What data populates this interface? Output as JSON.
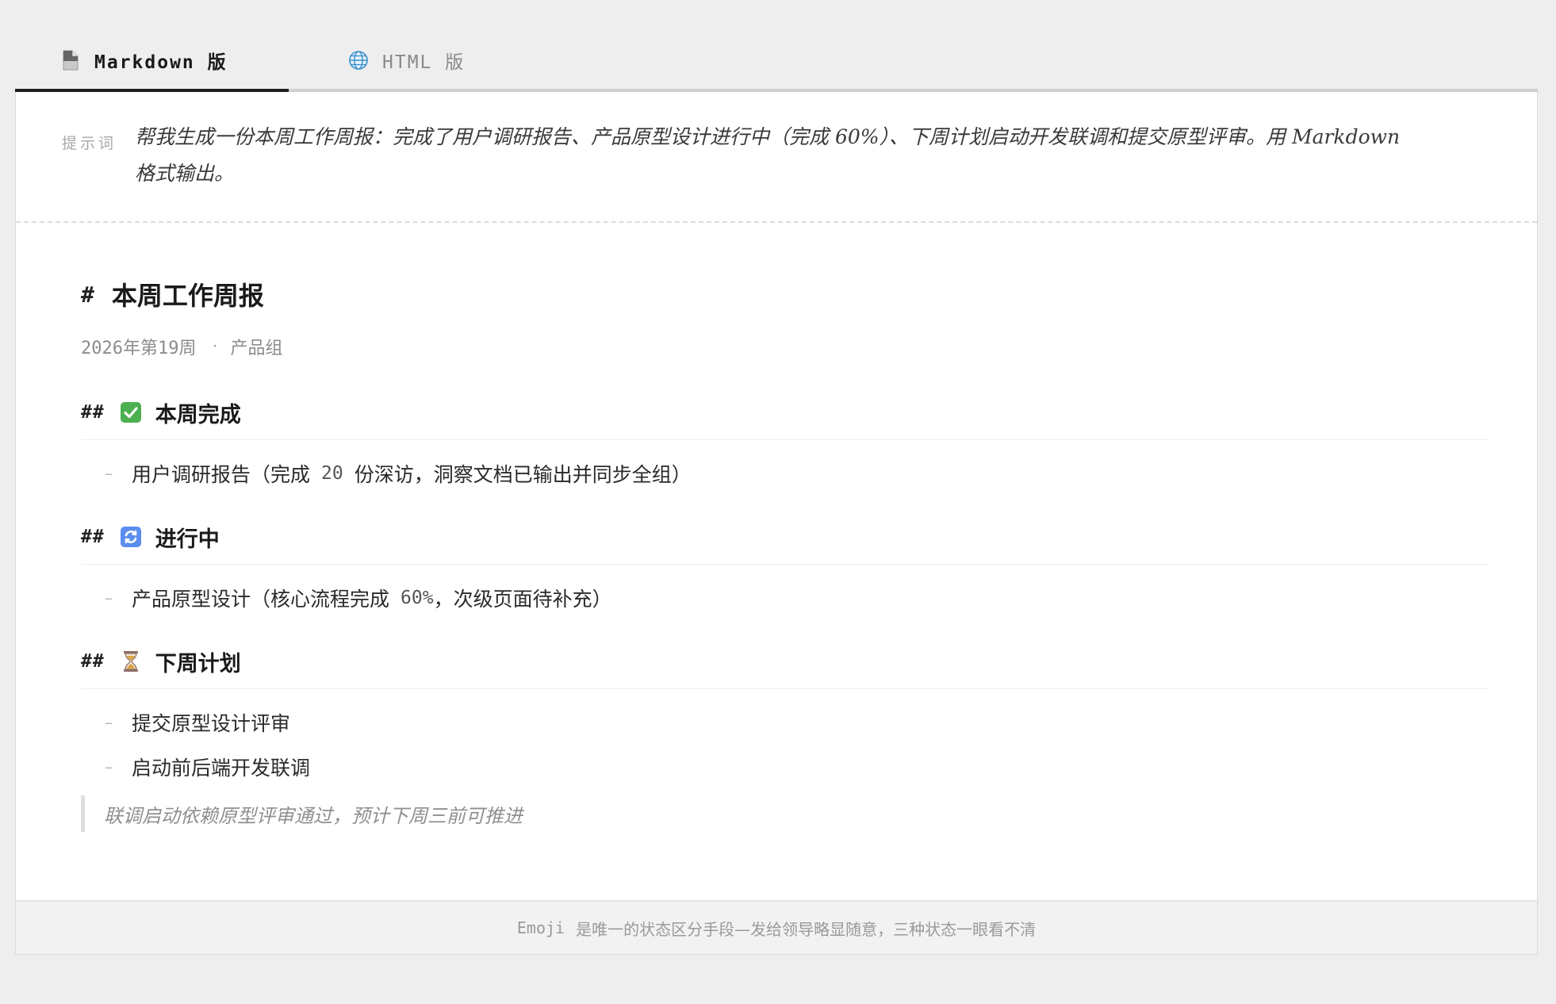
{
  "tabs": [
    {
      "label": "Markdown 版",
      "icon": "document-icon",
      "active": true
    },
    {
      "label": "HTML 版",
      "icon": "globe-icon",
      "active": false
    }
  ],
  "prompt": {
    "label": "提示词",
    "text": "帮我生成一份本周工作周报：完成了用户调研报告、产品原型设计进行中（完成 60%）、下周计划启动开发联调和提交原型评审。用 Markdown 格式输出。"
  },
  "doc": {
    "h1_hash": "#",
    "title": "本周工作周报",
    "meta_week": "2026年第19周",
    "meta_sep": "·",
    "meta_team": "产品组",
    "h2_hash": "##",
    "sections": [
      {
        "icon": "check-box-icon",
        "heading": "本周完成",
        "items": [
          {
            "before": "用户调研报告（完成",
            "num": "20",
            "after": "份深访，洞察文档已输出并同步全组）"
          }
        ]
      },
      {
        "icon": "refresh-icon",
        "heading": "进行中",
        "items": [
          {
            "before": "产品原型设计（核心流程完成",
            "num": "60%",
            "after": "，次级页面待补充）"
          }
        ]
      },
      {
        "icon": "hourglass-icon",
        "heading": "下周计划",
        "items": [
          {
            "text": "提交原型设计评审"
          },
          {
            "text": "启动前后端开发联调"
          }
        ],
        "quote": "联调启动依赖原型评审通过，预计下周三前可推进"
      }
    ],
    "dash": "–"
  },
  "footer": {
    "mono": "Emoji",
    "text": "是唯一的状态区分手段—发给领导略显随意，三种状态一眼看不清"
  },
  "colors": {
    "background": "#efeeee",
    "card": "#ffffff",
    "check_green": "#4caf50",
    "refresh_blue": "#5b8def"
  }
}
